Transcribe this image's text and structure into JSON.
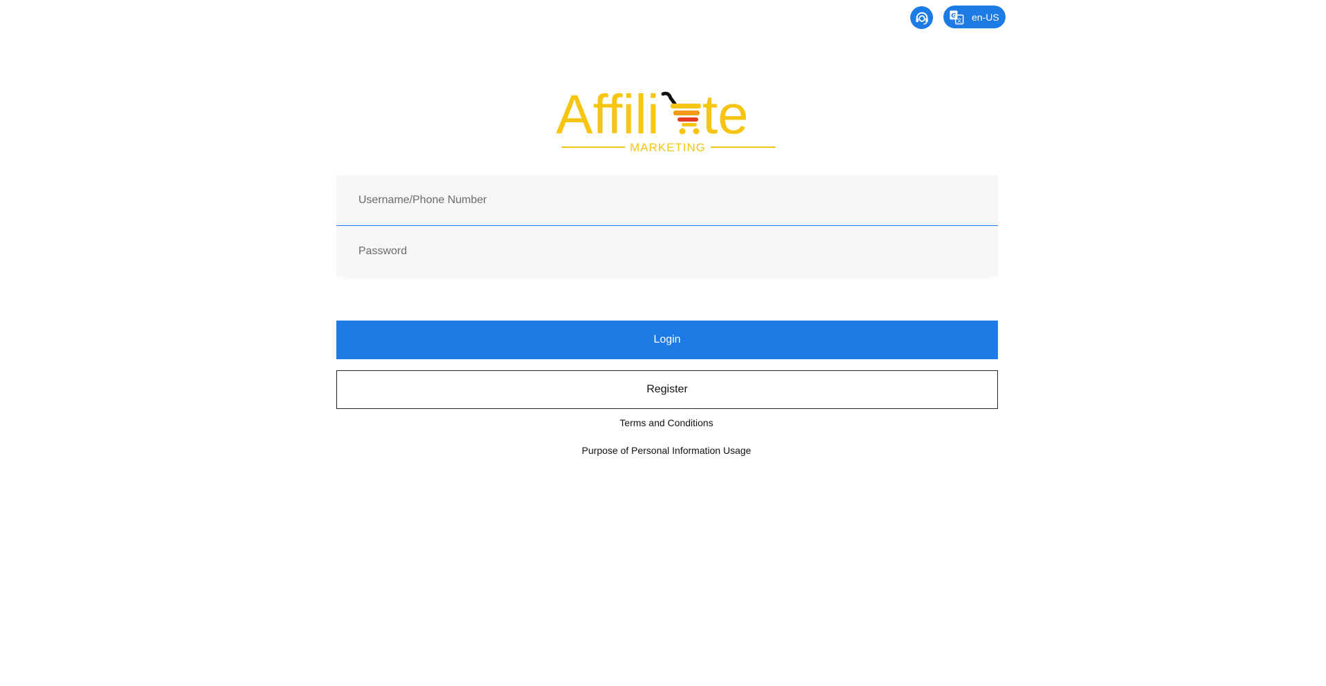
{
  "header": {
    "support_icon": "headset-icon",
    "language": {
      "icon": "translate-icon",
      "label": "en-US"
    }
  },
  "logo": {
    "text_left": "Affili",
    "text_right": "te",
    "subtitle": "MARKETING",
    "colors": {
      "primary": "#f6c512",
      "cart_red": "#e53b1f",
      "cart_orange": "#f59a14",
      "handle": "#111111"
    }
  },
  "form": {
    "username": {
      "placeholder": "Username/Phone Number",
      "value": ""
    },
    "password": {
      "placeholder": "Password",
      "value": ""
    }
  },
  "actions": {
    "login_label": "Login",
    "register_label": "Register"
  },
  "links": {
    "terms": "Terms and Conditions",
    "purpose": "Purpose of Personal Information Usage"
  },
  "colors": {
    "accent": "#1d7be6",
    "field_bg": "#f5f6f7"
  }
}
